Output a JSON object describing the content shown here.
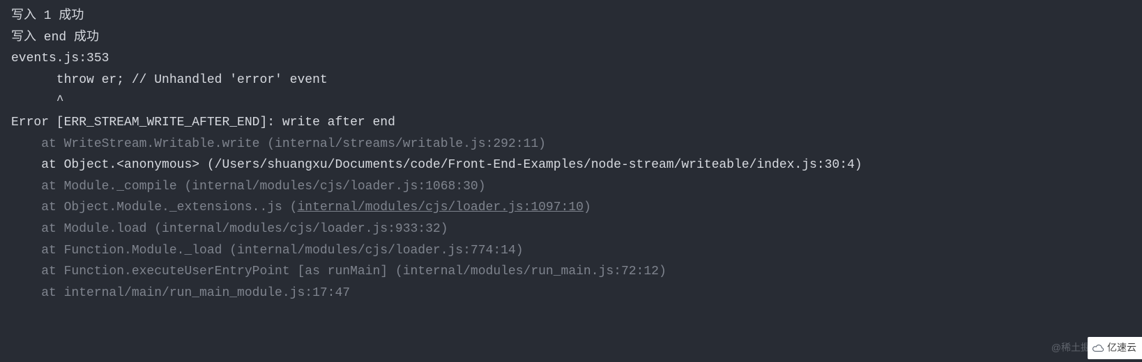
{
  "output": {
    "lines": [
      {
        "text": "写入 1 成功",
        "class": "bright"
      },
      {
        "text": "写入 end 成功",
        "class": "bright"
      },
      {
        "text": "events.js:353",
        "class": "bright"
      },
      {
        "text": "      throw er; // Unhandled 'error' event",
        "class": "bright"
      },
      {
        "text": "      ^",
        "class": "bright"
      },
      {
        "text": "",
        "class": "bright"
      },
      {
        "text": "Error [ERR_STREAM_WRITE_AFTER_END]: write after end",
        "class": "bright"
      },
      {
        "text": "    at WriteStream.Writable.write (internal/streams/writable.js:292:11)",
        "class": "dim"
      },
      {
        "text": "    at Object.<anonymous> (/Users/shuangxu/Documents/code/Front-End-Examples/node-stream/writeable/index.js:30:4)",
        "class": "bright"
      },
      {
        "text": "    at Module._compile (internal/modules/cjs/loader.js:1068:30)",
        "class": "dim"
      },
      {
        "prefix": "    at Object.Module._extensions..js (",
        "underlined": "internal/modules/cjs/loader.js:1097:10",
        "suffix": ")",
        "class": "dim",
        "hasUnderline": true
      },
      {
        "text": "    at Module.load (internal/modules/cjs/loader.js:933:32)",
        "class": "dim"
      },
      {
        "text": "    at Function.Module._load (internal/modules/cjs/loader.js:774:14)",
        "class": "dim"
      },
      {
        "text": "    at Function.executeUserEntryPoint [as runMain] (internal/modules/run_main.js:72:12)",
        "class": "dim"
      },
      {
        "text": "    at internal/main/run_main_module.js:17:47",
        "class": "dim"
      }
    ]
  },
  "watermarks": {
    "juejin": "@稀土掘金",
    "yisu": "亿速云"
  }
}
